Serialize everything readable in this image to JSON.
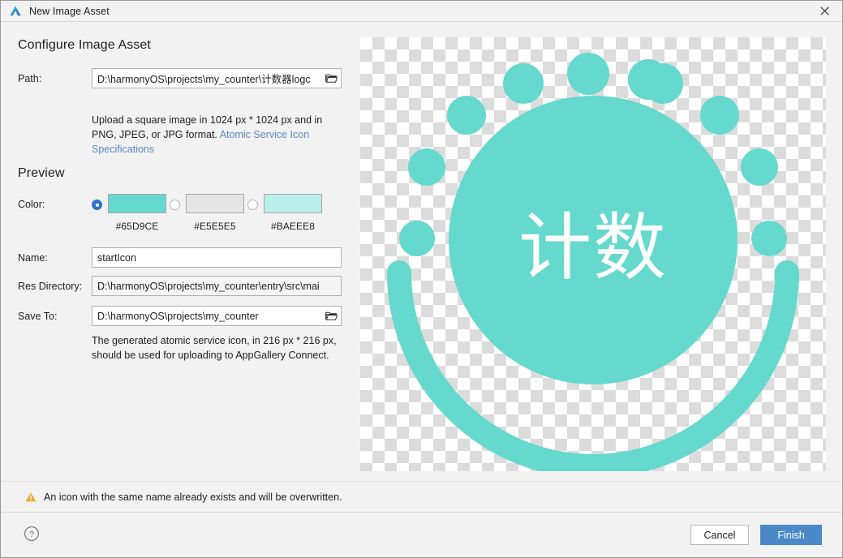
{
  "window": {
    "title": "New Image Asset",
    "logo_icon": "deveco-studio-logo-icon",
    "close_icon": "close-icon"
  },
  "configure": {
    "heading": "Configure Image Asset",
    "path": {
      "label": "Path:",
      "value": "D:\\harmonyOS\\projects\\my_counter\\计数器logc",
      "browse_icon": "folder-open-icon"
    },
    "help_text_part1": "Upload a square image in 1024 px * 1024 px and in PNG, JPEG, or JPG format. ",
    "help_link": "Atomic Service Icon Specifications"
  },
  "preview": {
    "heading": "Preview",
    "color": {
      "label": "Color:",
      "options": [
        {
          "hex": "#65D9CE",
          "label": "#65D9CE",
          "selected": true
        },
        {
          "hex": "#E5E5E5",
          "label": "#E5E5E5",
          "selected": false
        },
        {
          "hex": "#BAEEE8",
          "label": "#BAEEE8",
          "selected": false
        }
      ]
    },
    "name": {
      "label": "Name:",
      "value": "startIcon"
    },
    "res_directory": {
      "label": "Res Directory:",
      "value": "D:\\harmonyOS\\projects\\my_counter\\entry\\src\\mai"
    },
    "save_to": {
      "label": "Save To:",
      "value": "D:\\harmonyOS\\projects\\my_counter",
      "browse_icon": "folder-open-icon"
    },
    "help_text": "The generated atomic service icon, in 216 px * 216 px, should be used for uploading to AppGallery Connect.",
    "image": {
      "alt": "atomic-service-icon-preview",
      "glyph_text": "计数",
      "shape_color": "#65D9CE",
      "glyph_color": "#FFFFFF",
      "dot_count": 10
    }
  },
  "warning": {
    "icon": "warning-triangle-icon",
    "text": "An icon with the same name already exists and will be overwritten."
  },
  "footer": {
    "help_icon": "help-question-icon",
    "cancel_label": "Cancel",
    "finish_label": "Finish"
  }
}
